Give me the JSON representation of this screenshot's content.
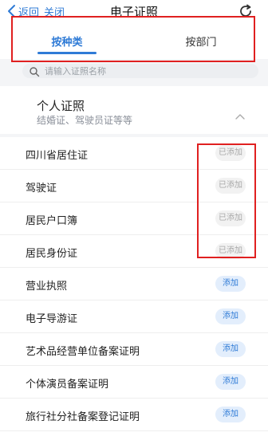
{
  "header": {
    "back_label": "返回",
    "close_label": "关闭",
    "title": "电子证照"
  },
  "tabs": [
    {
      "label": "按种类",
      "active": true
    },
    {
      "label": "按部门",
      "active": false
    }
  ],
  "search": {
    "placeholder": "请输入证照名称"
  },
  "section": {
    "title": "个人证照",
    "subtitle": "结婚证、驾驶员证等等"
  },
  "items": [
    {
      "name": "四川省居住证",
      "button": "已添加",
      "status": "added"
    },
    {
      "name": "驾驶证",
      "button": "已添加",
      "status": "added"
    },
    {
      "name": "居民户口簿",
      "button": "已添加",
      "status": "added"
    },
    {
      "name": "居民身份证",
      "button": "已添加",
      "status": "added"
    },
    {
      "name": "营业执照",
      "button": "添加",
      "status": "add"
    },
    {
      "name": "电子导游证",
      "button": "添加",
      "status": "add"
    },
    {
      "name": "艺术品经营单位备案证明",
      "button": "添加",
      "status": "add"
    },
    {
      "name": "个体演员备案证明",
      "button": "添加",
      "status": "add"
    },
    {
      "name": "旅行社分社备案登记证明",
      "button": "添加",
      "status": "add"
    }
  ],
  "colors": {
    "accent": "#2f7bd6",
    "annotation": "#e02020",
    "added_bg": "#f2f2f2",
    "add_bg": "#e3eefc"
  },
  "icons": [
    "back-chevron-icon",
    "refresh-icon",
    "search-icon",
    "chevron-up-icon"
  ]
}
